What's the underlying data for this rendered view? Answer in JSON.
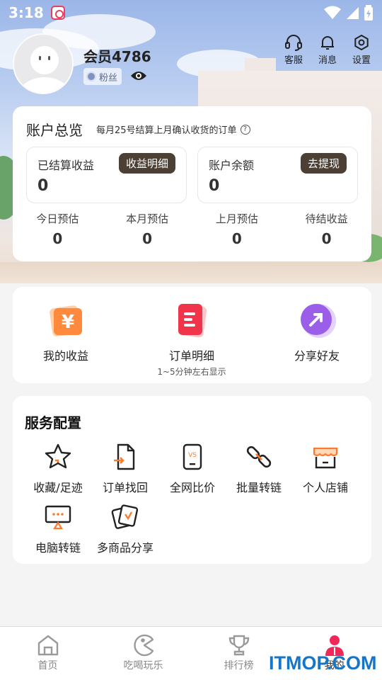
{
  "status_bar": {
    "time": "3:18"
  },
  "profile": {
    "username": "会员4786",
    "badge": "粉丝"
  },
  "top_actions": [
    {
      "label": "客服",
      "icon": "headset-icon"
    },
    {
      "label": "消息",
      "icon": "bell-icon"
    },
    {
      "label": "设置",
      "icon": "gear-icon"
    }
  ],
  "account": {
    "title": "账户总览",
    "note": "每月25号结算上月确认收货的订单",
    "settled": {
      "label": "已结算收益",
      "value": "0",
      "button": "收益明细"
    },
    "balance": {
      "label": "账户余额",
      "value": "0",
      "button": "去提现"
    },
    "stats": [
      {
        "label": "今日预估",
        "value": "0"
      },
      {
        "label": "本月预估",
        "value": "0"
      },
      {
        "label": "上月预估",
        "value": "0"
      },
      {
        "label": "待结收益",
        "value": "0"
      }
    ]
  },
  "quick": [
    {
      "label": "我的收益",
      "sub": "",
      "icon": "yen-icon"
    },
    {
      "label": "订单明细",
      "sub": "1~5分钟左右显示",
      "icon": "order-list-icon"
    },
    {
      "label": "分享好友",
      "sub": "",
      "icon": "share-arrow-icon"
    }
  ],
  "services": {
    "title": "服务配置",
    "items": [
      {
        "label": "收藏/足迹",
        "icon": "star-icon"
      },
      {
        "label": "订单找回",
        "icon": "file-retrieve-icon"
      },
      {
        "label": "全网比价",
        "icon": "compare-phone-icon"
      },
      {
        "label": "批量转链",
        "icon": "link-icon"
      },
      {
        "label": "个人店铺",
        "icon": "store-icon"
      },
      {
        "label": "电脑转链",
        "icon": "monitor-icon"
      },
      {
        "label": "多商品分享",
        "icon": "multi-product-icon"
      }
    ]
  },
  "bottom_nav": [
    {
      "label": "首页",
      "icon": "home-icon"
    },
    {
      "label": "吃喝玩乐",
      "icon": "pacman-icon"
    },
    {
      "label": "排行榜",
      "icon": "trophy-icon"
    },
    {
      "label": "我的",
      "icon": "user-icon"
    }
  ],
  "watermark": "ITMOP.COM",
  "colors": {
    "accent": "#4c3f34",
    "active_nav": "#f0285a",
    "watermark": "#1576c8"
  }
}
